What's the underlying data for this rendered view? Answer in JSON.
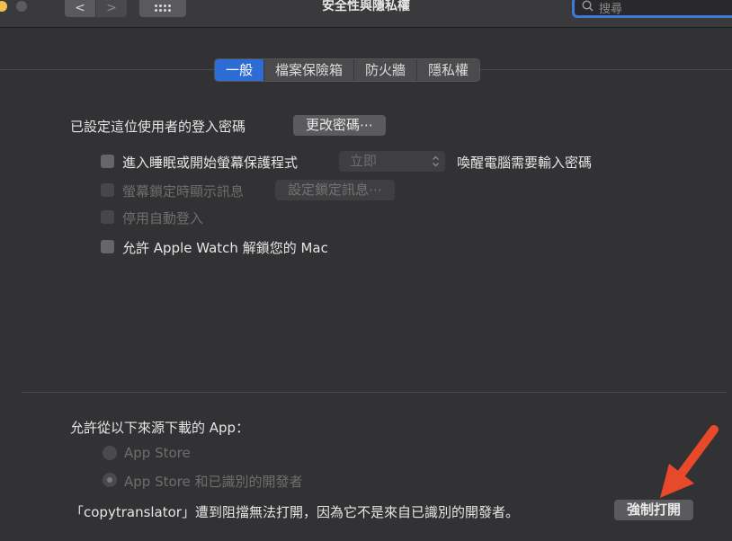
{
  "window": {
    "title": "安全性與隱私權",
    "search_placeholder": "搜尋",
    "nav": {
      "back_glyph": "<",
      "forward_glyph": ">"
    }
  },
  "tabs": [
    {
      "label": "一般",
      "active": true
    },
    {
      "label": "檔案保險箱",
      "active": false
    },
    {
      "label": "防火牆",
      "active": false
    },
    {
      "label": "隱私權",
      "active": false
    }
  ],
  "general": {
    "password_label": "已設定這位使用者的登入密碼",
    "change_password_button": "更改密碼⋯",
    "require_password_label": "進入睡眠或開始螢幕保護程式",
    "require_password_select": "立即",
    "require_password_suffix": "喚醒電腦需要輸入密碼",
    "show_message_label": "螢幕鎖定時顯示訊息",
    "set_lock_message_button": "設定鎖定訊息⋯",
    "disable_auto_login_label": "停用自動登入",
    "apple_watch_label": "允許 Apple Watch 解鎖您的 Mac"
  },
  "downloads": {
    "heading": "允許從以下來源下載的 App：",
    "option_app_store": "App Store",
    "option_identified": "App Store 和已識別的開發者",
    "blocked_message": "「copytranslator」遭到阻擋無法打開，因為它不是來自已識別的開發者。",
    "open_anyway_button": "強制打開"
  },
  "colors": {
    "accent": "#2c6cd4",
    "arrow": "#e8492a"
  },
  "icons": {
    "search": "magnifier",
    "chevron": "up-down-chevron",
    "grid": "grid-dots"
  }
}
